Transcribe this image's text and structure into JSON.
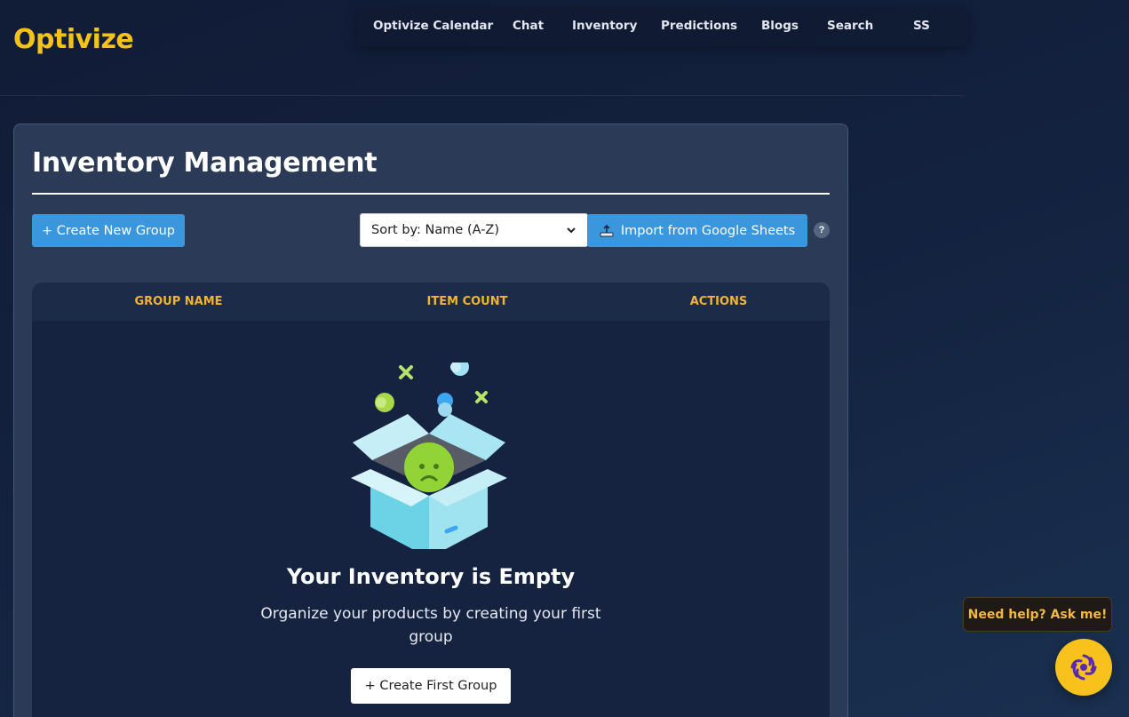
{
  "brand": "Optivize",
  "nav": {
    "items": [
      {
        "label": "Optivize Calendar"
      },
      {
        "label": "Chat"
      },
      {
        "label": "Inventory"
      },
      {
        "label": "Predictions"
      },
      {
        "label": "Blogs"
      },
      {
        "label": "Search"
      },
      {
        "label": "SS"
      }
    ]
  },
  "page": {
    "title": "Inventory Management",
    "create_group_label": "+ Create New Group",
    "sort": {
      "selected": "Sort by: Name (A-Z)"
    },
    "import_label": "Import from Google Sheets",
    "help_label": "?"
  },
  "table": {
    "columns": [
      "GROUP NAME",
      "ITEM COUNT",
      "ACTIONS"
    ]
  },
  "empty_state": {
    "title": "Your Inventory is Empty",
    "subtitle": "Organize your products by creating your first group",
    "button_label": "+ Create First Group"
  },
  "assistant": {
    "bubble_text": "Need help? Ask me!"
  },
  "colors": {
    "brand": "#f4c21c",
    "primary_button": "#3a97dd",
    "table_header_text": "#f0b432",
    "panel_bg": "#2b3a56"
  }
}
